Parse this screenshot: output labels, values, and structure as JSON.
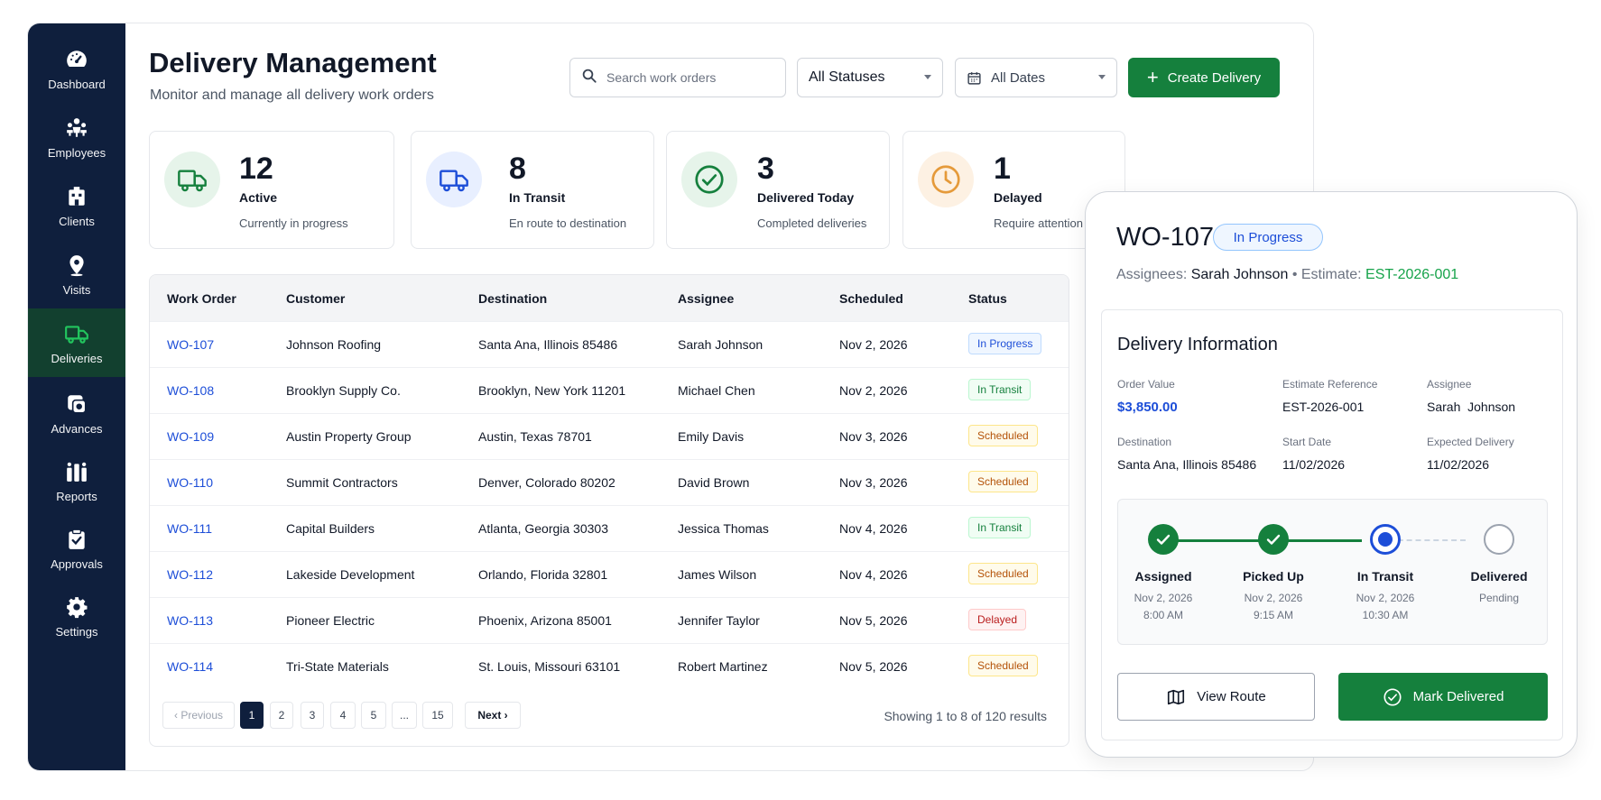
{
  "colors": {
    "sidebar": "#0f1f3d",
    "accent_green": "#15803d",
    "link_blue": "#1d4ed8"
  },
  "sidebar": {
    "items": [
      {
        "label": "Dashboard",
        "icon": "gauge-icon"
      },
      {
        "label": "Employees",
        "icon": "users-icon"
      },
      {
        "label": "Clients",
        "icon": "building-icon"
      },
      {
        "label": "Visits",
        "icon": "map-pin-icon"
      },
      {
        "label": "Deliveries",
        "icon": "truck-icon",
        "active": true
      },
      {
        "label": "Advances",
        "icon": "coins-icon"
      },
      {
        "label": "Reports",
        "icon": "bar-chart-icon"
      },
      {
        "label": "Approvals",
        "icon": "clipboard-check-icon"
      },
      {
        "label": "Settings",
        "icon": "gear-icon"
      }
    ]
  },
  "header": {
    "title": "Delivery Management",
    "subtitle": "Monitor and manage all delivery work orders",
    "search_placeholder": "Search work orders",
    "status_filter": "All Statuses",
    "date_filter": "All Dates",
    "create_label": "Create Delivery"
  },
  "stats": [
    {
      "value": "12",
      "label": "Active",
      "desc": "Currently in progress",
      "icon": "truck-icon",
      "color": "#15803d",
      "bg": "#e6f4ea"
    },
    {
      "value": "8",
      "label": "In Transit",
      "desc": "En route to destination",
      "icon": "truck-icon",
      "color": "#1d4ed8",
      "bg": "#e8efff"
    },
    {
      "value": "3",
      "label": "Delivered Today",
      "desc": "Completed deliveries",
      "icon": "check-circle-icon",
      "color": "#15803d",
      "bg": "#e6f4ea"
    },
    {
      "value": "1",
      "label": "Delayed",
      "desc": "Require attention",
      "icon": "clock-icon",
      "color": "#e59a3a",
      "bg": "#fdf1e3"
    }
  ],
  "table": {
    "columns": [
      "Work Order",
      "Customer",
      "Destination",
      "Assignee",
      "Scheduled",
      "Status"
    ],
    "rows": [
      {
        "wo": "WO-107",
        "customer": "Johnson Roofing",
        "destination": "Santa Ana, Illinois 85486",
        "assignee": "Sarah Johnson",
        "scheduled": "Nov 2, 2026",
        "status": "In Progress",
        "kind": "progress"
      },
      {
        "wo": "WO-108",
        "customer": "Brooklyn Supply Co.",
        "destination": "Brooklyn, New York 11201",
        "assignee": "Michael Chen",
        "scheduled": "Nov 2, 2026",
        "status": "In Transit",
        "kind": "transit"
      },
      {
        "wo": "WO-109",
        "customer": "Austin Property Group",
        "destination": "Austin, Texas 78701",
        "assignee": "Emily Davis",
        "scheduled": "Nov 3, 2026",
        "status": "Scheduled",
        "kind": "scheduled"
      },
      {
        "wo": "WO-110",
        "customer": "Summit Contractors",
        "destination": "Denver, Colorado 80202",
        "assignee": "David Brown",
        "scheduled": "Nov 3, 2026",
        "status": "Scheduled",
        "kind": "scheduled"
      },
      {
        "wo": "WO-111",
        "customer": "Capital Builders",
        "destination": "Atlanta, Georgia 30303",
        "assignee": "Jessica Thomas",
        "scheduled": "Nov 4, 2026",
        "status": "In Transit",
        "kind": "transit"
      },
      {
        "wo": "WO-112",
        "customer": "Lakeside Development",
        "destination": "Orlando, Florida 32801",
        "assignee": "James Wilson",
        "scheduled": "Nov 4, 2026",
        "status": "Scheduled",
        "kind": "scheduled"
      },
      {
        "wo": "WO-113",
        "customer": "Pioneer Electric",
        "destination": "Phoenix, Arizona 85001",
        "assignee": "Jennifer Taylor",
        "scheduled": "Nov 5, 2026",
        "status": "Delayed",
        "kind": "delayed"
      },
      {
        "wo": "WO-114",
        "customer": "Tri-State Materials",
        "destination": "St. Louis, Missouri 63101",
        "assignee": "Robert Martinez",
        "scheduled": "Nov 5, 2026",
        "status": "Scheduled",
        "kind": "scheduled"
      }
    ]
  },
  "pagination": {
    "previous": "‹ Previous",
    "pages": [
      "1",
      "2",
      "3",
      "4",
      "5",
      "...",
      "15"
    ],
    "current": "1",
    "next": "Next ›",
    "showing": "Showing 1 to 8 of 120 results"
  },
  "detail": {
    "wo": "WO-107",
    "status": "In Progress",
    "assignees_label": "Assignees:",
    "assignees": "Sarah Johnson",
    "sep": "•",
    "estimate_label": "Estimate:",
    "estimate": "EST-2026-001",
    "section_title": "Delivery Information",
    "fields": {
      "order_value_label": "Order Value",
      "order_value": "$3,850.00",
      "estimate_ref_label": "Estimate Reference",
      "estimate_ref": "EST-2026-001",
      "assignee_label": "Assignee",
      "assignee": "Sarah  Johnson",
      "destination_label": "Destination",
      "destination": "Santa Ana, Illinois 85486",
      "start_date_label": "Start Date",
      "start_date": "11/02/2026",
      "expected_label": "Expected Delivery",
      "expected": "11/02/2026"
    },
    "timeline": [
      {
        "name": "Assigned",
        "line1": "Nov 2, 2026",
        "line2": "8:00 AM",
        "state": "done"
      },
      {
        "name": "Picked Up",
        "line1": "Nov 2, 2026",
        "line2": "9:15 AM",
        "state": "done"
      },
      {
        "name": "In Transit",
        "line1": "Nov 2, 2026",
        "line2": "10:30 AM",
        "state": "current"
      },
      {
        "name": "Delivered",
        "line1": "Pending",
        "line2": "",
        "state": "pending"
      }
    ],
    "view_route_label": "View Route",
    "mark_delivered_label": "Mark Delivered"
  }
}
